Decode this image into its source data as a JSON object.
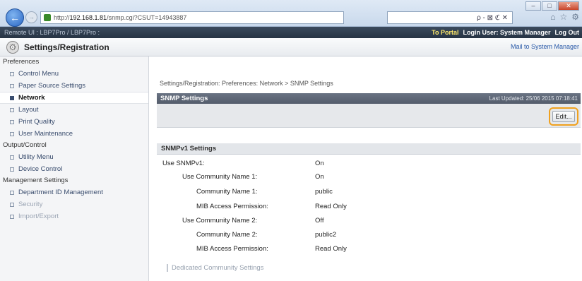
{
  "browser": {
    "back_glyph": "←",
    "forward_glyph": "→",
    "url_prefix": "http://",
    "url_host": "192.168.1.81",
    "url_path": "/snmp.cgi?CSUT=14943887",
    "addr_tools": "ρ - ⊠ ℭ ✕",
    "min_glyph": "‒",
    "max_glyph": "□",
    "close_glyph": "✕",
    "home_glyph": "⌂",
    "fav_glyph": "☆",
    "settings_glyph": "⚙"
  },
  "topbar": {
    "left_text": "Remote UI : LBP7Pro / LBP7Pro :",
    "to_portal": "To Portal",
    "login_user": "Login User: System Manager",
    "log_out": "Log Out"
  },
  "header": {
    "title": "Settings/Registration",
    "mail_link": "Mail to System Manager"
  },
  "sidebar": {
    "sections": [
      {
        "heading": "Preferences",
        "items": [
          {
            "label": "Control Menu",
            "active": false
          },
          {
            "label": "Paper Source Settings",
            "active": false
          },
          {
            "label": "Network",
            "active": true
          },
          {
            "label": "Layout",
            "active": false
          },
          {
            "label": "Print Quality",
            "active": false
          },
          {
            "label": "User Maintenance",
            "active": false
          }
        ]
      },
      {
        "heading": "Output/Control",
        "items": [
          {
            "label": "Utility Menu",
            "active": false
          },
          {
            "label": "Device Control",
            "active": false
          }
        ]
      },
      {
        "heading": "Management Settings",
        "items": [
          {
            "label": "Department ID Management",
            "active": false
          },
          {
            "label": "Security",
            "active": false
          },
          {
            "label": "Import/Export",
            "active": false
          }
        ]
      }
    ]
  },
  "main": {
    "breadcrumb": "Settings/Registration: Preferences: Network > SNMP Settings",
    "panel_title": "SNMP Settings",
    "last_updated": "Last Updated: 25/06 2015 07:18:41",
    "edit_label": "Edit...",
    "section_title": "SNMPv1 Settings",
    "rows": [
      {
        "label": "Use SNMPv1:",
        "value": "On"
      },
      {
        "label": "Use Community Name 1:",
        "value": "On"
      },
      {
        "label": "Community Name 1:",
        "value": "public"
      },
      {
        "label": "MIB Access Permission:",
        "value": "Read Only"
      },
      {
        "label": "Use Community Name 2:",
        "value": "Off"
      },
      {
        "label": "Community Name 2:",
        "value": "public2"
      },
      {
        "label": "MIB Access Permission:",
        "value": "Read Only"
      }
    ],
    "subsection": "Dedicated Community Settings"
  }
}
